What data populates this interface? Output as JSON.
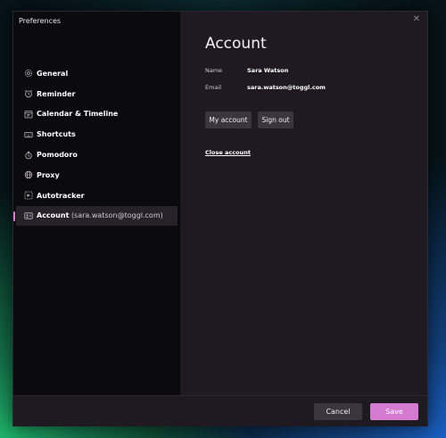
{
  "window": {
    "title": "Preferences"
  },
  "sidebar": {
    "items": [
      {
        "label": "General",
        "icon": "gear-icon"
      },
      {
        "label": "Reminder",
        "icon": "alarm-clock-icon"
      },
      {
        "label": "Calendar & Timeline",
        "icon": "calendar-icon"
      },
      {
        "label": "Shortcuts",
        "icon": "keyboard-icon"
      },
      {
        "label": "Pomodoro",
        "icon": "timer-icon"
      },
      {
        "label": "Proxy",
        "icon": "globe-icon"
      },
      {
        "label": "Autotracker",
        "icon": "autotracker-icon"
      },
      {
        "label": "Account",
        "sublabel": "(sara.watson@toggl.com)",
        "icon": "account-card-icon",
        "active": true
      }
    ]
  },
  "account": {
    "heading": "Account",
    "name_label": "Name",
    "name_value": "Sara Watson",
    "email_label": "Email",
    "email_value": "sara.watson@toggl.com",
    "my_account_label": "My account",
    "sign_out_label": "Sign out",
    "close_account_label": "Close account"
  },
  "footer": {
    "cancel_label": "Cancel",
    "save_label": "Save"
  },
  "colors": {
    "accent": "#d47ad0",
    "sidebar_bg": "#0b0a0d",
    "content_bg": "#1f1a22",
    "button_bg": "#3a363f"
  }
}
